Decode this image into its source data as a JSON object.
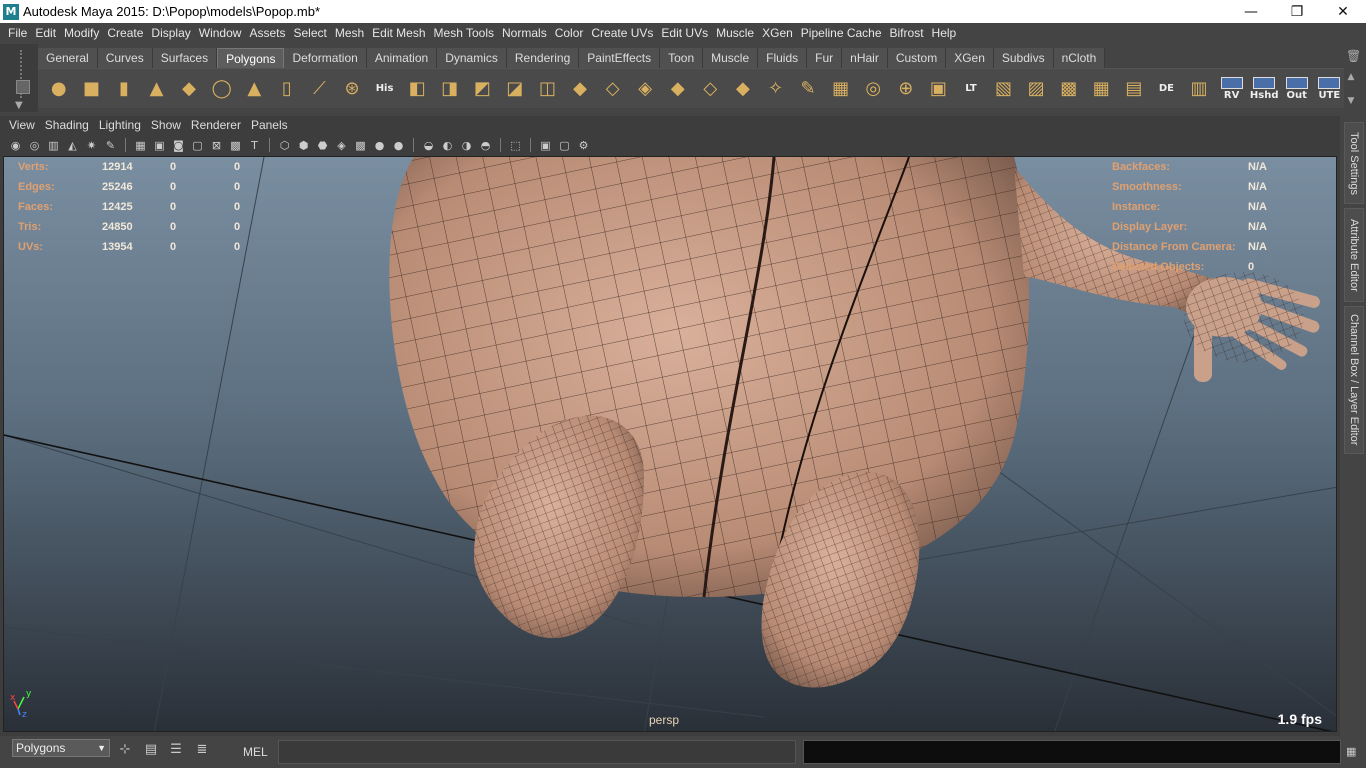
{
  "window": {
    "title": "Autodesk Maya 2015: D:\\Popop\\models\\Popop.mb*",
    "app_icon_letter": "M",
    "minimize_glyph": "—",
    "restore_glyph": "❐",
    "close_glyph": "✕"
  },
  "menubar": [
    "File",
    "Edit",
    "Modify",
    "Create",
    "Display",
    "Window",
    "Assets",
    "Select",
    "Mesh",
    "Edit Mesh",
    "Mesh Tools",
    "Normals",
    "Color",
    "Create UVs",
    "Edit UVs",
    "Muscle",
    "XGen",
    "Pipeline Cache",
    "Bifrost",
    "Help"
  ],
  "shelf": {
    "tabs": [
      "General",
      "Curves",
      "Surfaces",
      "Polygons",
      "Deformation",
      "Animation",
      "Dynamics",
      "Rendering",
      "PaintEffects",
      "Toon",
      "Muscle",
      "Fluids",
      "Fur",
      "nHair",
      "Custom",
      "XGen",
      "Subdivs",
      "nCloth"
    ],
    "active_tab": "Polygons",
    "text_icons": {
      "his": "His",
      "lt": "LT",
      "de": "DE",
      "rv": "RV",
      "hshd": "Hshd",
      "out": "Out",
      "ute": "UTE"
    }
  },
  "panel_menu": [
    "View",
    "Shading",
    "Lighting",
    "Show",
    "Renderer",
    "Panels"
  ],
  "hud": {
    "left": [
      {
        "label": "Verts:",
        "value": "12914",
        "sel": "0",
        "uv": "0"
      },
      {
        "label": "Edges:",
        "value": "25246",
        "sel": "0",
        "uv": "0"
      },
      {
        "label": "Faces:",
        "value": "12425",
        "sel": "0",
        "uv": "0"
      },
      {
        "label": "Tris:",
        "value": "24850",
        "sel": "0",
        "uv": "0"
      },
      {
        "label": "UVs:",
        "value": "13954",
        "sel": "0",
        "uv": "0"
      }
    ],
    "right": [
      {
        "label": "Backfaces:",
        "value": "N/A"
      },
      {
        "label": "Smoothness:",
        "value": "N/A"
      },
      {
        "label": "Instance:",
        "value": "N/A"
      },
      {
        "label": "Display Layer:",
        "value": "N/A"
      },
      {
        "label": "Distance From Camera:",
        "value": "N/A"
      },
      {
        "label": "Selected Objects:",
        "value": "0"
      }
    ],
    "camera": "persp",
    "fps": "1.9 fps",
    "axis_y": "y",
    "axis_x": "x",
    "axis_z": "z"
  },
  "side_tabs": [
    "Tool Settings",
    "Attribute Editor",
    "Channel Box / Layer Editor"
  ],
  "command_line": {
    "mode": "Polygons",
    "language": "MEL",
    "input_value": "",
    "result_value": ""
  },
  "colors": {
    "accent": "#5d5d5d",
    "hud_label": "#e0a070",
    "viewport_top": "#7a8ea1",
    "viewport_bottom": "#2a3038",
    "skin": "#c89e88"
  }
}
